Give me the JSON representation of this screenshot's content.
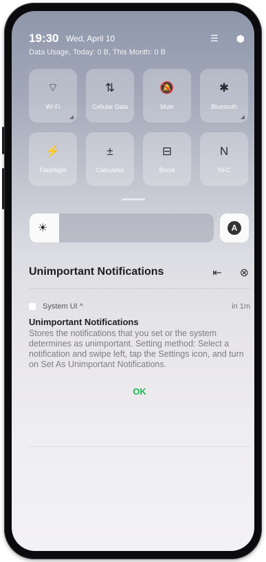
{
  "status": {
    "time": "19:30",
    "date": "Wed, April 10",
    "data_usage": "Data Usage, Today: 0 B, This Month: 0 B"
  },
  "header_icons": [
    {
      "icon": "edit-tiles-icon",
      "glyph": "☰"
    },
    {
      "icon": "settings-icon",
      "glyph": "⬢"
    }
  ],
  "tiles": [
    {
      "label": "Wi-Fi",
      "icon": "wifi-icon",
      "glyph": "⌔",
      "expandable": true
    },
    {
      "label": "Cellular Data",
      "icon": "cellular-data-icon",
      "glyph": "⇅",
      "expandable": false
    },
    {
      "label": "Mute",
      "icon": "mute-icon",
      "glyph": "🔕",
      "expandable": false
    },
    {
      "label": "Bluetooth",
      "icon": "bluetooth-icon",
      "glyph": "✱",
      "expandable": true
    },
    {
      "label": "Flashlight",
      "icon": "flashlight-icon",
      "glyph": "⚡",
      "expandable": false
    },
    {
      "label": "Calculator",
      "icon": "calculator-icon",
      "glyph": "±",
      "expandable": false
    },
    {
      "label": "Boost",
      "icon": "boost-icon",
      "glyph": "⊟",
      "expandable": false
    },
    {
      "label": "NFC",
      "icon": "nfc-icon",
      "glyph": "N",
      "expandable": false
    }
  ],
  "brightness": {
    "level": 0.16,
    "auto_label": "A"
  },
  "notifications": {
    "section_title": "Unimportant Notifications",
    "app_name": "System UI ^",
    "time": "in 1m",
    "title": "Unimportant Notifications",
    "body": "Stores the notifications that you set or the system determines as unimportant. Setting method: Select a notification and swipe left, tap the Settings icon, and turn on Set As Unimportant Notifications.",
    "ok_label": "OK"
  },
  "colors": {
    "accent": "#1db954"
  }
}
